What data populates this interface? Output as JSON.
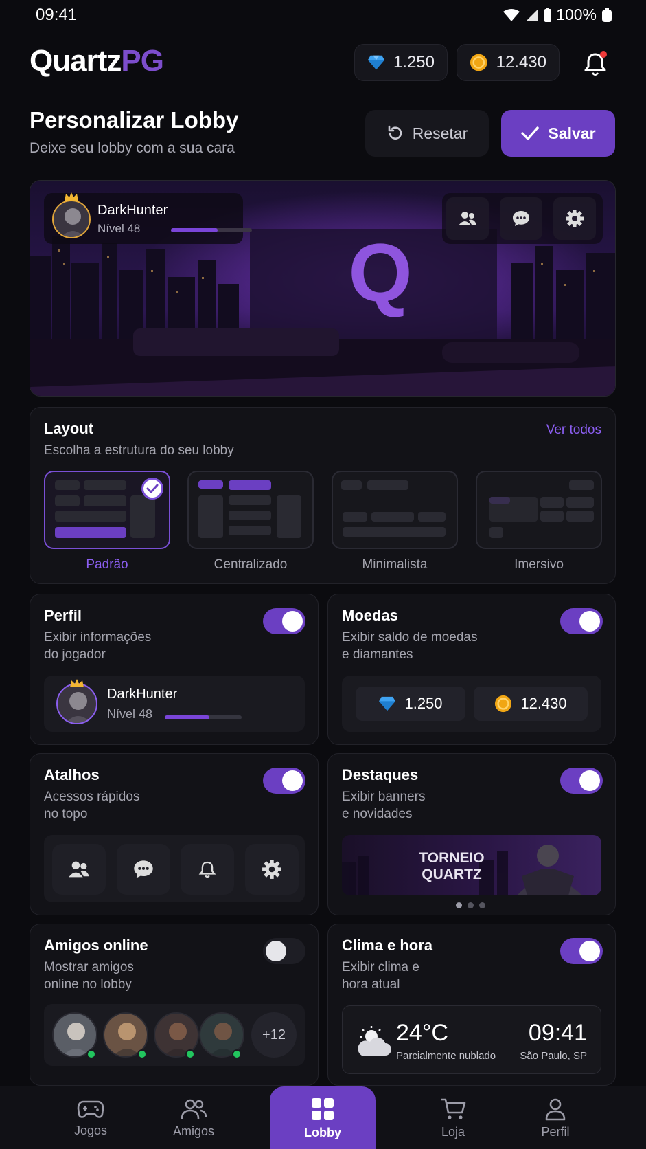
{
  "status": {
    "time": "09:41",
    "battery": "100%"
  },
  "brand": {
    "name_a": "Quartz",
    "name_b": "PG",
    "accent": "#6b3fc2"
  },
  "wallet": {
    "diamonds": "1.250",
    "coins": "12.430"
  },
  "page": {
    "title": "Personalizar Lobby",
    "subtitle": "Deixe seu lobby com a sua cara",
    "reset": "Resetar",
    "save": "Salvar"
  },
  "player": {
    "name": "DarkHunter",
    "level": "Nível 48",
    "xp_progress": 0.58
  },
  "layout": {
    "title": "Layout",
    "subtitle": "Escolha a estrutura do seu lobby",
    "see_all": "Ver todos",
    "options": [
      "Padrão",
      "Centralizado",
      "Minimalista",
      "Imersivo"
    ],
    "selected": "Padrão"
  },
  "widgets": {
    "perfil": {
      "title": "Perfil",
      "desc1": "Exibir informações",
      "desc2": "do jogador",
      "enabled": true
    },
    "moedas": {
      "title": "Moedas",
      "desc1": "Exibir saldo de moedas",
      "desc2": "e diamantes",
      "enabled": true
    },
    "atalhos": {
      "title": "Atalhos",
      "desc1": "Acessos rápidos",
      "desc2": "no topo",
      "enabled": true
    },
    "destaques": {
      "title": "Destaques",
      "desc1": "Exibir banners",
      "desc2": "e novidades",
      "enabled": true,
      "banner1": "TORNEIO",
      "banner2": "QUARTZ"
    },
    "amigos": {
      "title": "Amigos online",
      "desc1": "Mostrar amigos",
      "desc2": "online no lobby",
      "enabled": false,
      "more": "+12"
    },
    "clima": {
      "title": "Clima e hora",
      "desc1": "Exibir clima e",
      "desc2": "hora atual",
      "enabled": true,
      "temp": "24°C",
      "condition": "Parcialmente nublado",
      "time": "09:41",
      "city": "São Paulo, SP"
    }
  },
  "nav": [
    {
      "label": "Jogos",
      "icon": "gamepad-icon"
    },
    {
      "label": "Amigos",
      "icon": "users-icon"
    },
    {
      "label": "Lobby",
      "icon": "grid-icon",
      "active": true
    },
    {
      "label": "Loja",
      "icon": "cart-icon"
    },
    {
      "label": "Perfil",
      "icon": "user-icon"
    }
  ]
}
